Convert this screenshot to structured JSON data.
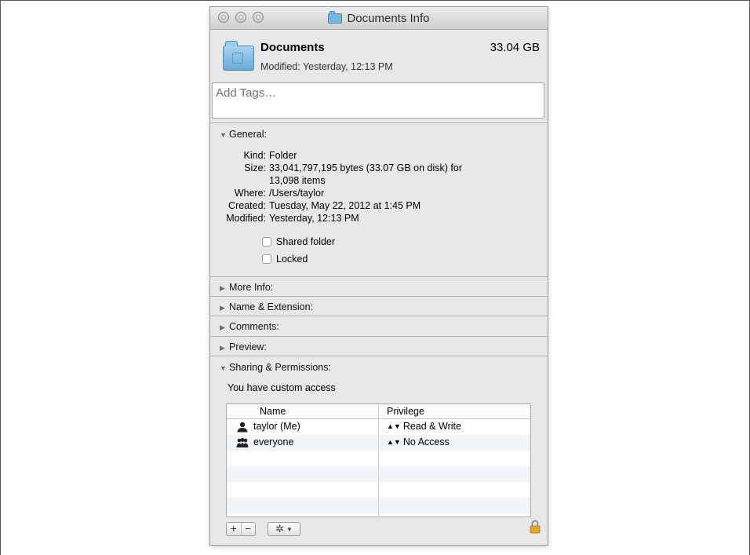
{
  "window": {
    "title": "Documents Info"
  },
  "header": {
    "name": "Documents",
    "size": "33.04 GB",
    "modified": "Modified: Yesterday, 12:13 PM"
  },
  "tags": {
    "placeholder": "Add Tags…"
  },
  "sections": {
    "general": "General:",
    "more_info": "More Info:",
    "name_ext": "Name & Extension:",
    "comments": "Comments:",
    "preview": "Preview:",
    "sharing": "Sharing & Permissions:"
  },
  "general": {
    "kind_label": "Kind:",
    "kind": "Folder",
    "size_label": "Size:",
    "size_line1": "33,041,797,195 bytes (33.07 GB on disk) for",
    "size_line2": "13,098 items",
    "where_label": "Where:",
    "where": "/Users/taylor",
    "created_label": "Created:",
    "created": "Tuesday, May 22, 2012 at 1:45 PM",
    "modified_label": "Modified:",
    "modified": "Yesterday, 12:13 PM",
    "shared_folder": "Shared folder",
    "locked": "Locked",
    "shared_checked": false,
    "locked_checked": false
  },
  "sharing": {
    "access_text": "You have custom access",
    "columns": [
      "Name",
      "Privilege"
    ],
    "rows": [
      {
        "name": "taylor (Me)",
        "privilege": "Read & Write",
        "icon": "single-user-icon"
      },
      {
        "name": "everyone",
        "privilege": "No Access",
        "icon": "group-users-icon"
      }
    ]
  },
  "toolbar": {
    "add": "+",
    "remove": "−",
    "gear": "✲"
  }
}
